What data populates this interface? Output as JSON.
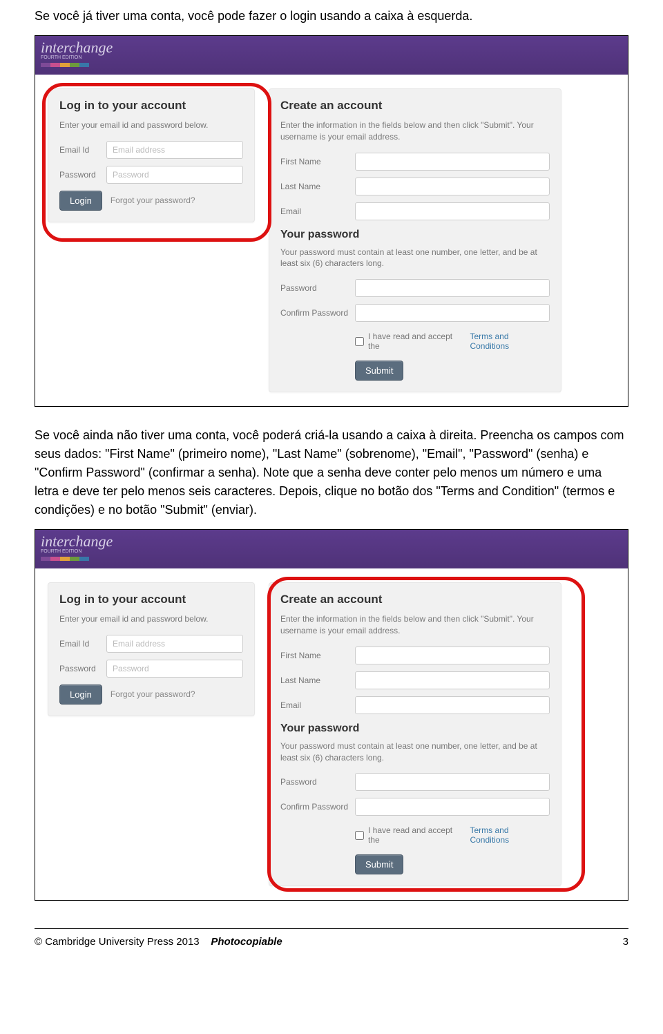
{
  "intro1": "Se você já tiver uma conta, você pode fazer o login usando a caixa à esquerda.",
  "intro2": "Se você ainda não tiver uma conta, você poderá criá-la usando a caixa à direita. Preencha os campos com seus dados: \"First Name\" (primeiro nome), \"Last Name\" (sobrenome), \"Email\", \"Password\" (senha) e \"Confirm Password\" (confirmar a senha). Note que a senha deve conter pelo menos um número e uma letra e deve ter pelo menos seis caracteres. Depois, clique no botão dos \"Terms and Condition\" (termos e condições) e no botão \"Submit\" (enviar).",
  "logo": {
    "text": "interchange",
    "sub": "FOURTH EDITION"
  },
  "login": {
    "heading": "Log in to your account",
    "sub": "Enter your email id and password below.",
    "email_label": "Email Id",
    "email_placeholder": "Email address",
    "password_label": "Password",
    "password_placeholder": "Password",
    "button": "Login",
    "forgot": "Forgot your password?"
  },
  "create": {
    "heading": "Create an account",
    "sub": "Enter the information in the fields below and then click \"Submit\". Your username is your email address.",
    "first_label": "First Name",
    "last_label": "Last Name",
    "email_label": "Email",
    "pw_heading": "Your password",
    "pw_sub": "Your password must contain at least one number, one letter, and be at least six (6) characters long.",
    "pw_label": "Password",
    "cpw_label": "Confirm Password",
    "tc_text": "I have read and accept the ",
    "tc_link": "Terms and Conditions",
    "submit": "Submit"
  },
  "footer": {
    "copyright": "© Cambridge University Press 2013",
    "pc": "Photocopiable",
    "page": "3"
  }
}
